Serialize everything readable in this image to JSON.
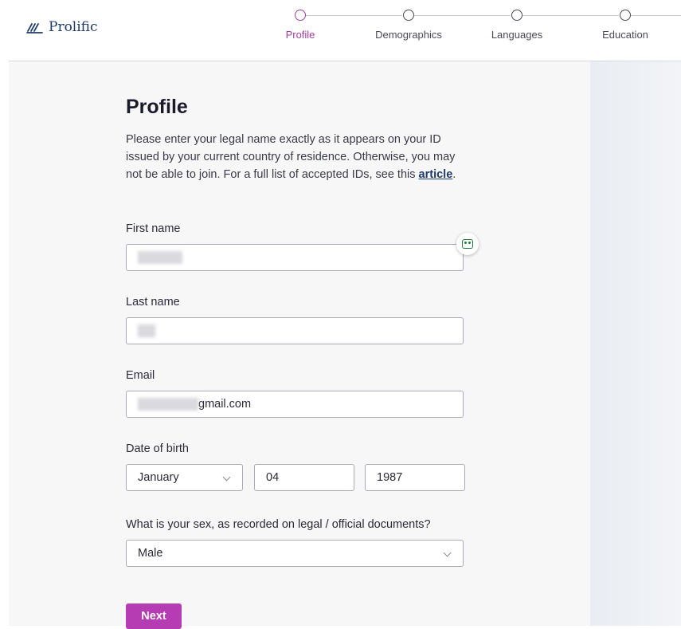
{
  "brand": {
    "name": "Prolific"
  },
  "steps": [
    {
      "label": "Profile",
      "active": true
    },
    {
      "label": "Demographics",
      "active": false
    },
    {
      "label": "Languages",
      "active": false
    },
    {
      "label": "Education",
      "active": false
    }
  ],
  "page": {
    "title": "Profile",
    "intro_text": "Please enter your legal name exactly as it appears on your ID issued by your current country of residence. Otherwise, you may not be able to join. For a full list of accepted IDs, see this ",
    "intro_link": "article",
    "intro_end": "."
  },
  "form": {
    "first_name_label": "First name",
    "last_name_label": "Last name",
    "email_label": "Email",
    "email_value_visible": "gmail.com",
    "dob_label": "Date of birth",
    "dob_month": "January",
    "dob_day": "04",
    "dob_year": "1987",
    "sex_label": "What is your sex, as recorded on legal / official documents?",
    "sex_value": "Male"
  },
  "actions": {
    "next_label": "Next"
  },
  "colors": {
    "accent": "#b53cb2",
    "brand": "#1d3a6b"
  }
}
